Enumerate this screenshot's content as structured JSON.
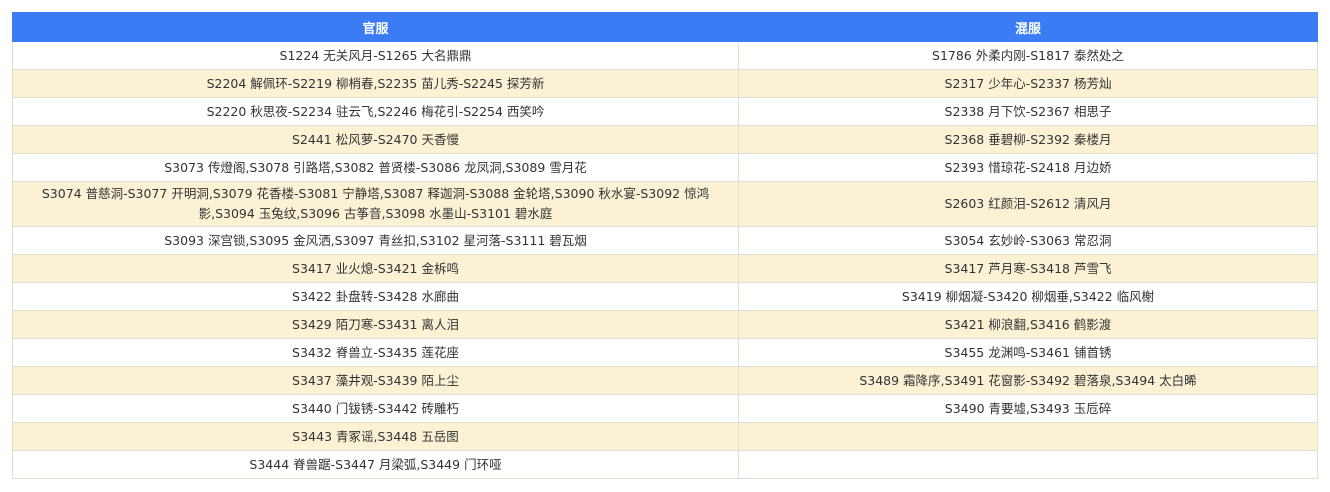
{
  "headers": [
    "官服",
    "混服"
  ],
  "rows": [
    [
      "S1224 无关风月-S1265 大名鼎鼎",
      "S1786 外柔内刚-S1817 泰然处之"
    ],
    [
      "S2204 解佩环-S2219 柳梢春,S2235 苗儿秀-S2245 探芳新",
      "S2317 少年心-S2337 杨芳灿"
    ],
    [
      "S2220 秋思夜-S2234 驻云飞,S2246 梅花引-S2254 西笑吟",
      "S2338 月下饮-S2367 相思子"
    ],
    [
      "S2441 松风萝-S2470 天香慢",
      "S2368 垂碧柳-S2392 秦楼月"
    ],
    [
      "S3073 传燈阁,S3078 引路塔,S3082 普贤楼-S3086 龙凤洞,S3089 雪月花",
      "S2393 惜琼花-S2418 月边娇"
    ],
    [
      "S3074 普慈洞-S3077 开明洞,S3079 花香楼-S3081 宁静塔,S3087 释迦洞-S3088 金轮塔,S3090 秋水宴-S3092 惊鸿影,S3094 玉兔纹,S3096 古筝音,S3098 水墨山-S3101 碧水庭",
      "S2603 红颜泪-S2612 清风月"
    ],
    [
      "S3093 深宫锁,S3095 金风洒,S3097 青丝扣,S3102 星河落-S3111 碧瓦烟",
      "S3054 玄妙岭-S3063 常忍洞"
    ],
    [
      "S3417 业火熄-S3421 金柝鸣",
      "S3417 芦月寒-S3418 芦雪飞"
    ],
    [
      "S3422 卦盘转-S3428 水廊曲",
      "S3419 柳烟凝-S3420 柳烟垂,S3422 临风榭"
    ],
    [
      "S3429 陌刀寒-S3431 离人泪",
      "S3421 柳浪翻,S3416 鹤影渡"
    ],
    [
      "S3432 脊兽立-S3435 莲花座",
      "S3455 龙渊鸣-S3461 铺首锈"
    ],
    [
      "S3437 藻井观-S3439 陌上尘",
      "S3489 霜降序,S3491 花窗影-S3492 碧落泉,S3494 太白晞"
    ],
    [
      "S3440 门钹锈-S3442 砖雕朽",
      "S3490 青要墟,S3493 玉卮碎"
    ],
    [
      "S3443 青冢谣,S3448 五岳图",
      ""
    ],
    [
      "S3444 脊兽踞-S3447 月梁弧,S3449 门环哑",
      ""
    ]
  ]
}
